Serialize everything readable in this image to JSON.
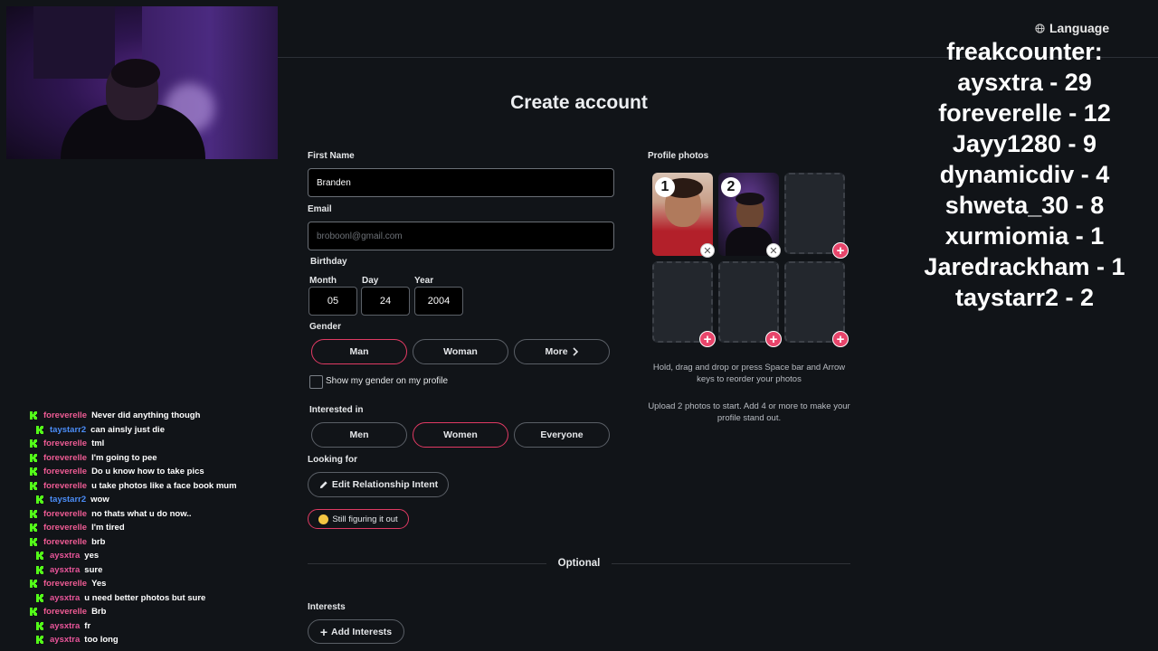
{
  "language": {
    "label": "Language",
    "icon": "globe-icon"
  },
  "counter": {
    "title": "freakcounter:",
    "entries": [
      "aysxtra - 29",
      "foreverelle - 12",
      "Jayy1280 - 9",
      "dynamicdiv - 4",
      "shweta_30 - 8",
      "xurmiomia - 1",
      "Jaredrackham - 1",
      "taystarr2 - 2"
    ]
  },
  "chat": {
    "badge_color": "#53fc18",
    "messages": [
      {
        "user": "foreverelle",
        "color": "#ee5b94",
        "text": "Never did anything though",
        "indent": false
      },
      {
        "user": "taystarr2",
        "color": "#4b8df8",
        "text": "can ainsly just die",
        "indent": true
      },
      {
        "user": "foreverelle",
        "color": "#ee5b94",
        "text": "tml",
        "indent": false
      },
      {
        "user": "foreverelle",
        "color": "#ee5b94",
        "text": "I'm going to pee",
        "indent": false
      },
      {
        "user": "foreverelle",
        "color": "#ee5b94",
        "text": "Do u know how to take pics",
        "indent": false
      },
      {
        "user": "foreverelle",
        "color": "#ee5b94",
        "text": "u take photos like a face book mum",
        "indent": false
      },
      {
        "user": "taystarr2",
        "color": "#4b8df8",
        "text": "wow",
        "indent": true
      },
      {
        "user": "foreverelle",
        "color": "#ee5b94",
        "text": "no thats what u do now..",
        "indent": false
      },
      {
        "user": "foreverelle",
        "color": "#ee5b94",
        "text": "I'm tired",
        "indent": false
      },
      {
        "user": "foreverelle",
        "color": "#ee5b94",
        "text": "brb",
        "indent": false
      },
      {
        "user": "aysxtra",
        "color": "#e9559a",
        "text": "yes",
        "indent": true
      },
      {
        "user": "aysxtra",
        "color": "#e9559a",
        "text": "sure",
        "indent": true
      },
      {
        "user": "foreverelle",
        "color": "#ee5b94",
        "text": "Yes",
        "indent": false
      },
      {
        "user": "aysxtra",
        "color": "#e9559a",
        "text": "u need better photos but sure",
        "indent": true
      },
      {
        "user": "foreverelle",
        "color": "#ee5b94",
        "text": "Brb",
        "indent": false
      },
      {
        "user": "aysxtra",
        "color": "#e9559a",
        "text": "fr",
        "indent": true
      },
      {
        "user": "aysxtra",
        "color": "#e9559a",
        "text": "too long",
        "indent": true
      }
    ]
  },
  "form": {
    "title": "Create account",
    "first_name": {
      "label": "First Name",
      "value": "Branden"
    },
    "email": {
      "label": "Email",
      "placeholder": "broboonl@gmail.com"
    },
    "birthday": {
      "label": "Birthday",
      "month_label": "Month",
      "month": "05",
      "day_label": "Day",
      "day": "24",
      "year_label": "Year",
      "year": "2004"
    },
    "gender": {
      "label": "Gender",
      "options": [
        "Man",
        "Woman",
        "More"
      ],
      "selected": "Man",
      "show_on_profile": "Show my gender on my profile"
    },
    "interested_in": {
      "label": "Interested in",
      "options": [
        "Men",
        "Women",
        "Everyone"
      ],
      "selected": "Women"
    },
    "looking_for": {
      "label": "Looking for",
      "edit_button": "Edit Relationship Intent",
      "selected_intent": "Still figuring it out"
    },
    "optional_label": "Optional",
    "interests": {
      "label": "Interests",
      "add_button": "Add Interests"
    },
    "accent_color": "#e03a63"
  },
  "photos": {
    "label": "Profile photos",
    "numbers": [
      "1",
      "2"
    ],
    "help_reorder": "Hold, drag and drop or press Space bar and Arrow keys to reorder your photos",
    "help_upload": "Upload 2 photos to start. Add 4 or more to make your profile stand out."
  }
}
